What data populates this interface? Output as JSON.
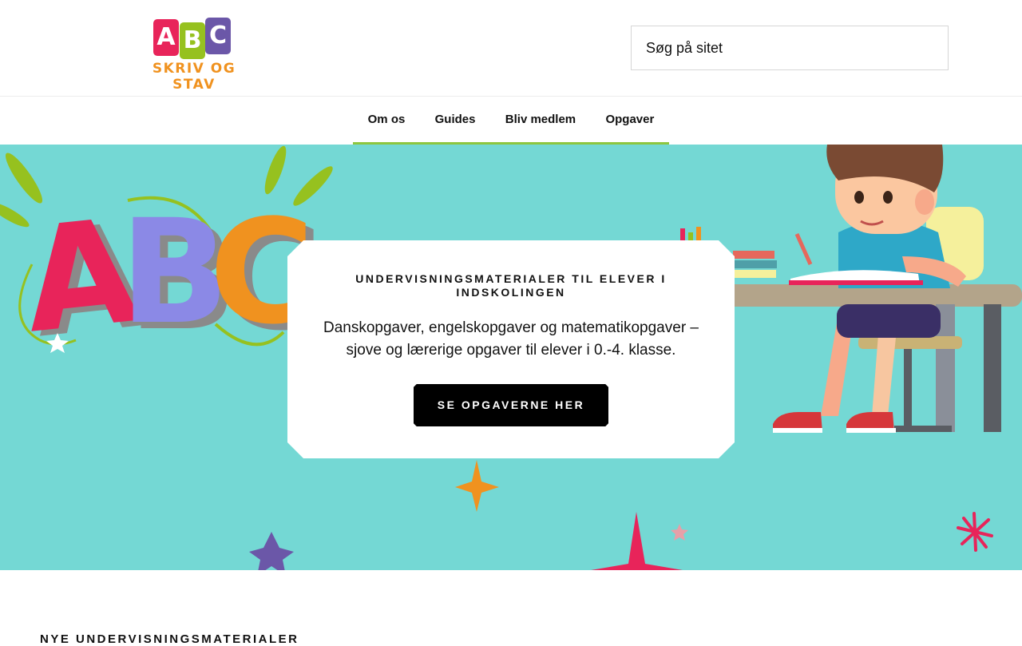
{
  "logo": {
    "letters": [
      "A",
      "B",
      "C"
    ],
    "wordmark": "SKRIV OG STAV"
  },
  "search": {
    "placeholder": "Søg på sitet"
  },
  "nav": {
    "items": [
      "Om os",
      "Guides",
      "Bliv medlem",
      "Opgaver"
    ]
  },
  "hero": {
    "eyebrow": "UNDERVISNINGSMATERIALER TIL ELEVER I INDSKOLINGEN",
    "description": "Danskopgaver, engelskopgaver og matematikopgaver – sjove og lærerige opgaver til elever i 0.-4. klasse.",
    "cta_label": "SE OPGAVERNE HER",
    "illustration_letters": [
      "A",
      "B",
      "C"
    ]
  },
  "section": {
    "title": "NYE UNDERVISNINGSMATERIALER"
  },
  "colors": {
    "hero_bg": "#74d8d4",
    "nav_accent": "#8dc63f",
    "logo_text": "#f0921f"
  }
}
